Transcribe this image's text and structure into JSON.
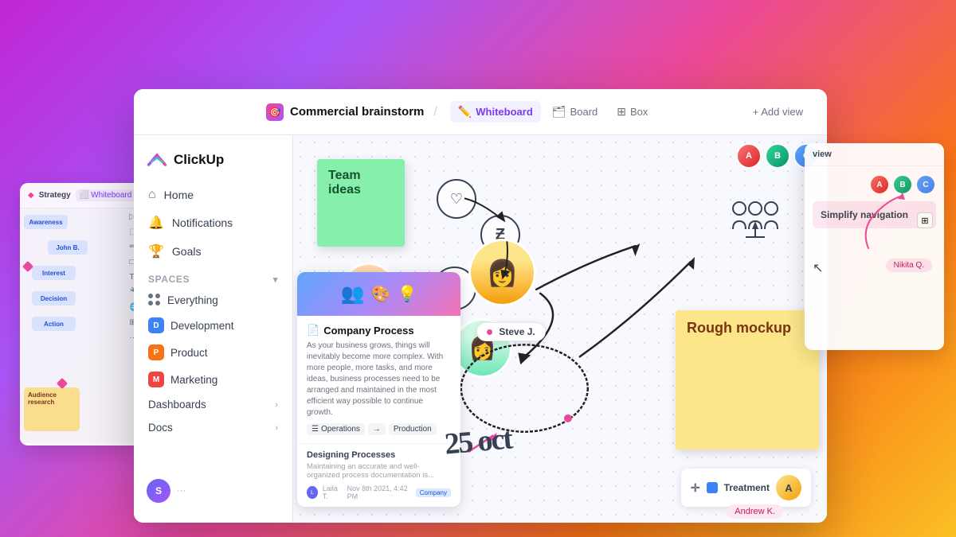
{
  "app": {
    "name": "ClickUp"
  },
  "header": {
    "project_icon": "🎯",
    "project_name": "Commercial brainstorm",
    "tabs": [
      {
        "id": "whiteboard",
        "label": "Whiteboard",
        "icon": "⬜",
        "active": true
      },
      {
        "id": "board",
        "label": "Board",
        "icon": "🗂"
      },
      {
        "id": "box",
        "label": "Box",
        "icon": "⊞"
      }
    ],
    "add_view_label": "+ Add view"
  },
  "sidebar": {
    "nav": [
      {
        "id": "home",
        "label": "Home",
        "icon": "home"
      },
      {
        "id": "notifications",
        "label": "Notifications",
        "icon": "bell"
      },
      {
        "id": "goals",
        "label": "Goals",
        "icon": "trophy"
      }
    ],
    "spaces_label": "Spaces",
    "spaces": [
      {
        "id": "everything",
        "label": "Everything",
        "type": "dots"
      },
      {
        "id": "development",
        "label": "Development",
        "badge": "D",
        "color": "badge-d"
      },
      {
        "id": "product",
        "label": "Product",
        "badge": "P",
        "color": "badge-p"
      },
      {
        "id": "marketing",
        "label": "Marketing",
        "badge": "M",
        "color": "badge-m"
      }
    ],
    "extras": [
      {
        "id": "dashboards",
        "label": "Dashboards"
      },
      {
        "id": "docs",
        "label": "Docs"
      }
    ],
    "user_initial": "S"
  },
  "whiteboard": {
    "sticky_green_text": "Team ideas",
    "sticky_yellow_text": "Rough mockup",
    "doc_card": {
      "title": "Company Process",
      "body_text": "As your business grows, things will inevitably become more complex. With more people, more tasks, and more ideas, business processes need to be arranged and maintained in the most efficient way possible to continue growth.",
      "tags": [
        "Operations",
        "Production"
      ],
      "section_title": "Designing Processes",
      "section_text": "Maintaining an accurate and well-organized process documentation is...",
      "author": "Laila T.",
      "date": "Nov 8th 2021, 4:42 PM",
      "company_tag": "Company"
    },
    "name_tag": "Steve J.",
    "date_label": "25 oct",
    "treatment_label": "Treatment",
    "andrew_label": "Andrew K.",
    "nikita_label": "Nikita Q.",
    "simplify_label": "Simplify navigation"
  },
  "float_left": {
    "tab1": "Strategy",
    "tab2": "Whiteboard"
  },
  "float_right": {
    "content": "Simplify navigation"
  }
}
